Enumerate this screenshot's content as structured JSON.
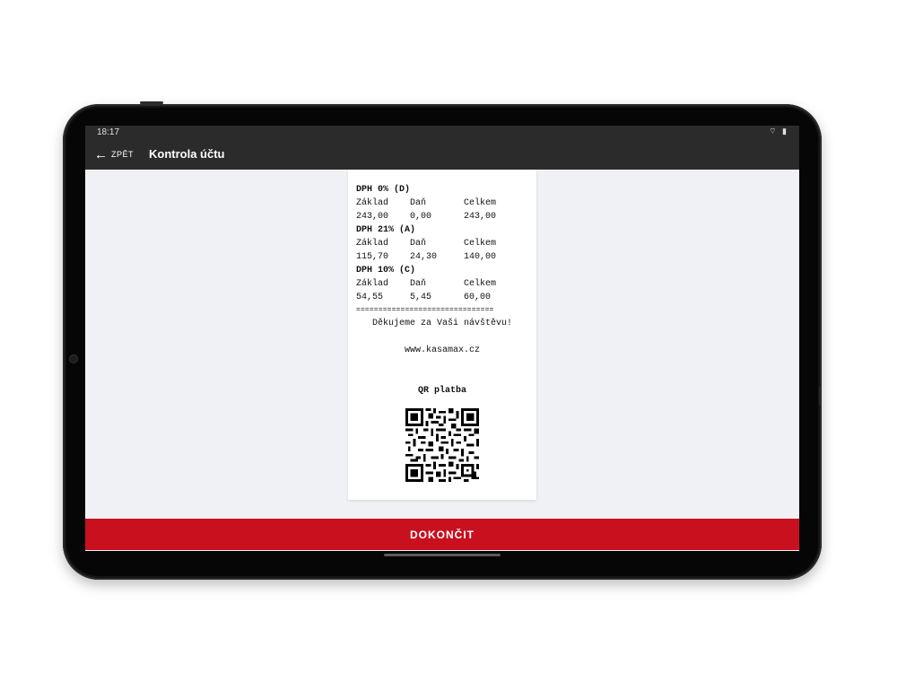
{
  "statusbar": {
    "time": "18:17",
    "icons": "wifi-icon battery-icon"
  },
  "appbar": {
    "back_label": "ZPĚT",
    "title": "Kontrola účtu"
  },
  "receipt": {
    "vat_groups": [
      {
        "header": "DPH 0% (D)",
        "col_base": "Základ",
        "col_tax": "Daň",
        "col_total": "Celkem",
        "base": "243,00",
        "tax": "0,00",
        "total": "243,00"
      },
      {
        "header": "DPH 21% (A)",
        "col_base": "Základ",
        "col_tax": "Daň",
        "col_total": "Celkem",
        "base": "115,70",
        "tax": "24,30",
        "total": "140,00"
      },
      {
        "header": "DPH 10% (C)",
        "col_base": "Základ",
        "col_tax": "Daň",
        "col_total": "Celkem",
        "base": "54,55",
        "tax": "5,45",
        "total": "60,00"
      }
    ],
    "separator": "===============================",
    "thanks": "Děkujeme za Vaši návštěvu!",
    "website": "www.kasamax.cz",
    "qr_label": "QR platba"
  },
  "actions": {
    "finish_label": "DOKONČIT",
    "finish_color": "#c8101e"
  }
}
